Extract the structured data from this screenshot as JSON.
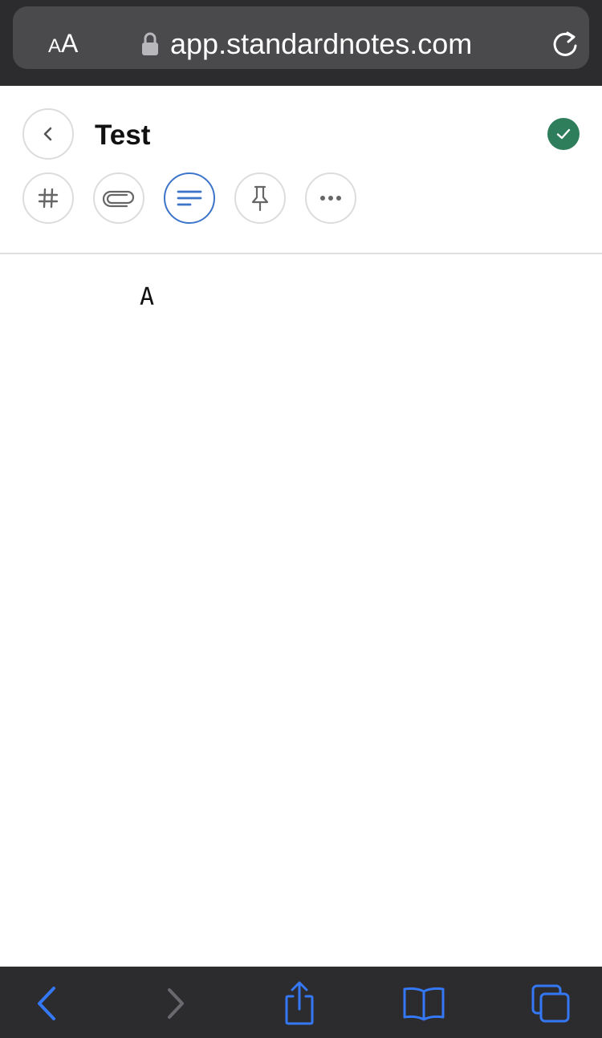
{
  "browser": {
    "text_size_button": {
      "small": "A",
      "large": "A"
    },
    "url": "app.standardnotes.com",
    "icons": {
      "lock": "lock-icon",
      "reload": "reload-icon"
    }
  },
  "note": {
    "title": "Test",
    "body": "A",
    "saved": true,
    "toolbar": [
      {
        "id": "tags",
        "icon": "hash-icon",
        "active": false
      },
      {
        "id": "attachments",
        "icon": "paperclip-icon",
        "active": false
      },
      {
        "id": "editor",
        "icon": "text-lines-icon",
        "active": true
      },
      {
        "id": "pin",
        "icon": "pin-icon",
        "active": false
      },
      {
        "id": "more",
        "icon": "more-icon",
        "active": false
      }
    ]
  },
  "bottom_toolbar": {
    "icons": [
      "back-icon",
      "forward-icon",
      "share-icon",
      "bookmarks-icon",
      "tabs-icon"
    ]
  },
  "colors": {
    "browser_chrome": "#2c2c2e",
    "address_bar": "#4a4a4c",
    "accent": "#3b74c9",
    "saved_green": "#2e7d5b",
    "ios_blue": "#3478f6"
  }
}
